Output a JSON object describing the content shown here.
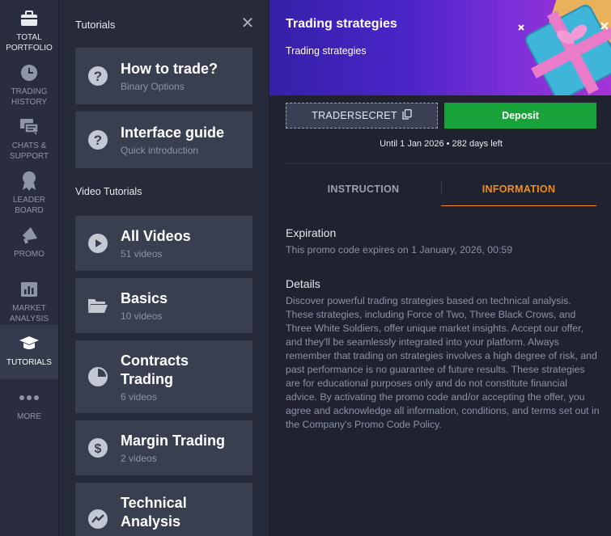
{
  "nav": [
    {
      "label": "TOTAL PORTFOLIO",
      "icon": "briefcase-icon",
      "active": false
    },
    {
      "label": "TRADING HISTORY",
      "icon": "clock-icon",
      "active": false
    },
    {
      "label": "CHATS & SUPPORT",
      "icon": "chat-icon",
      "active": false
    },
    {
      "label": "LEADER BOARD",
      "icon": "medal-icon",
      "active": false
    },
    {
      "label": "PROMO",
      "icon": "megaphone-icon",
      "active": false
    },
    {
      "label": "MARKET ANALYSIS",
      "icon": "chart-bar-icon",
      "active": false
    },
    {
      "label": "TUTORIALS",
      "icon": "graduation-cap-icon",
      "active": true
    },
    {
      "label": "MORE",
      "icon": "more-dots-icon",
      "active": false
    }
  ],
  "tutorials": {
    "title": "Tutorials",
    "video_label": "Video Tutorials",
    "cards": [
      {
        "name": "How to trade?",
        "sub": "Binary Options",
        "icon": "question-icon"
      },
      {
        "name": "Interface guide",
        "sub": "Quick introduction",
        "icon": "question-icon"
      },
      {
        "name": "All Videos",
        "sub": "51 videos",
        "icon": "play-icon"
      },
      {
        "name": "Basics",
        "sub": "10 videos",
        "icon": "folder-icon"
      },
      {
        "name": "Contracts Trading",
        "sub": "6 videos",
        "icon": "pie-icon"
      },
      {
        "name": "Margin Trading",
        "sub": "2 videos",
        "icon": "dollar-icon"
      },
      {
        "name": "Technical Analysis",
        "sub": "",
        "icon": "trend-icon"
      }
    ]
  },
  "promo": {
    "title": "Trading strategies",
    "subtitle": "Trading strategies",
    "code": "TRADERSECRET",
    "deposit_label": "Deposit",
    "until": "Until 1 Jan 2026 • 282 days left",
    "tabs": [
      {
        "label": "INSTRUCTION",
        "active": false
      },
      {
        "label": "INFORMATION",
        "active": true
      }
    ],
    "expiration_head": "Expiration",
    "expiration_text": "This promo code expires on 1 January, 2026, 00:59",
    "details_head": "Details",
    "details_text": "Discover powerful trading strategies based on technical analysis. These strategies, including Force of Two, Three Black Crows, and Three White Soldiers, offer unique market insights. Accept our offer, and they'll be seamlessly integrated into your platform. Always remember that trading on strategies involves a high degree of risk, and past performance is no guarantee of future results. These strategies are for educational purposes only and do not constitute financial advice. By activating the promo code and/or accepting the offer, you agree and acknowledge all information, conditions, and terms set out in the Company's Promo Code Policy."
  },
  "colors": {
    "accent": "#f28c1a",
    "deposit": "#17a23a",
    "nav_bg": "#292d3d"
  }
}
